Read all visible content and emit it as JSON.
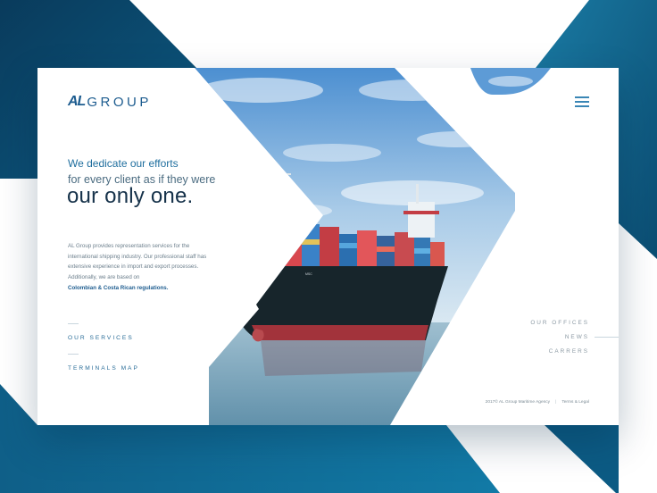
{
  "brand": {
    "mark": "AL",
    "word": "GROUP"
  },
  "menu": {
    "icon": "hamburger-icon"
  },
  "hero": {
    "line1": "We dedicate our efforts",
    "line2": "for every client as if they were",
    "headline": "our only one.",
    "description": "AL Group provides representation services for the international shipping industry. Our professional staff has extensive experience in import and export processes. Additionally, we are based on",
    "description_link": "Colombian & Costa Rican regulations."
  },
  "nav_left": [
    "OUR SERVICES",
    "TERMINALS MAP"
  ],
  "nav_right": [
    "OUR OFFICES",
    "NEWS",
    "CARRERS"
  ],
  "footer": {
    "copyright": "2017© AL Group Maritime Agency",
    "separator": "|",
    "legal": "Terms & Legal"
  },
  "colors": {
    "accent": "#1d5c8f",
    "dark_teal": "#0d4d73",
    "background_shape": "#0e5a82"
  }
}
